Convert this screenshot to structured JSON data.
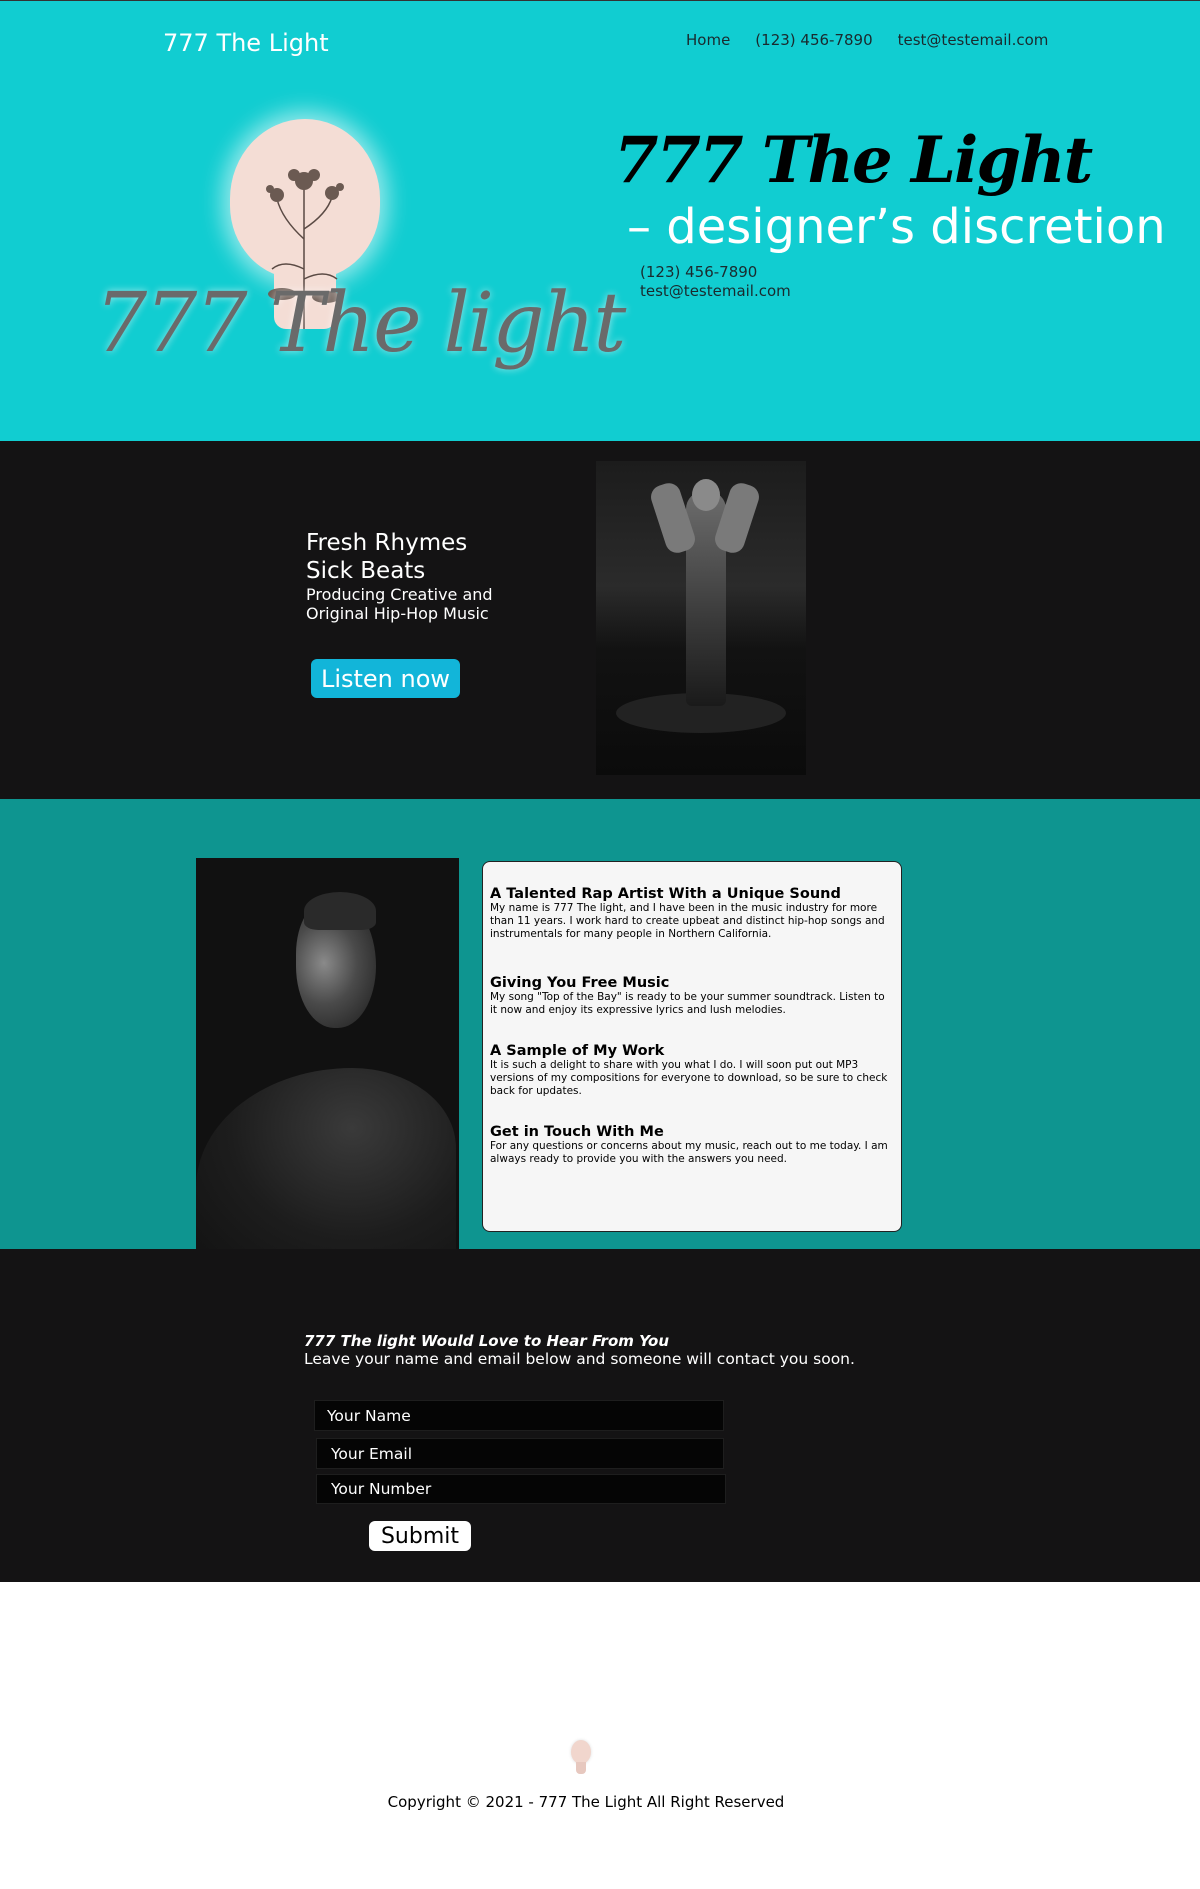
{
  "header": {
    "site_title": "777 The Light",
    "nav": {
      "home": "Home",
      "phone": "(123) 456-7890",
      "email": "test@testemail.com"
    }
  },
  "hero": {
    "logo_text": "777 The light",
    "title": "777 The Light",
    "subtitle": "– designer’s discretion",
    "phone": "(123) 456-7890",
    "email": "test@testemail.com"
  },
  "promo": {
    "line1": "Fresh Rhymes",
    "line2": "Sick Beats",
    "desc1": "Producing Creative and",
    "desc2": "Original Hip-Hop Music",
    "button": "Listen now"
  },
  "about": {
    "items": [
      {
        "heading": "A Talented Rap Artist With a Unique Sound",
        "body": "My name is 777 The light, and I have been in the music industry for more than 11 years. I work hard to create upbeat and distinct hip-hop songs and instrumentals for many people in Northern California."
      },
      {
        "heading": "Giving You Free Music",
        "body": "My song \"Top of the Bay\" is ready to be your summer soundtrack. Listen to it now and enjoy its expressive lyrics and lush melodies."
      },
      {
        "heading": "A Sample of My Work",
        "body": "It is such a delight to share with you what I do. I will soon put out MP3 versions of my compositions for everyone to download, so be sure to check back for updates."
      },
      {
        "heading": "Get in Touch With Me",
        "body": "For any questions or concerns about my music, reach out to me today. I am always ready to provide you with the answers you need."
      }
    ]
  },
  "contact_form": {
    "title": "777 The light Would Love to Hear From You",
    "subtitle": "Leave your name and email below and someone will contact you soon.",
    "name_placeholder": "Your Name",
    "email_placeholder": "Your Email",
    "number_placeholder": "Your Number",
    "submit": "Submit"
  },
  "footer": {
    "copyright": "Copyright © 2021 - 777 The Light All Right Reserved"
  },
  "colors": {
    "hero_bg": "#11cdd1",
    "dark_bg": "#141314",
    "teal_bg": "#0e9590",
    "button_blue": "#12b5d9"
  }
}
